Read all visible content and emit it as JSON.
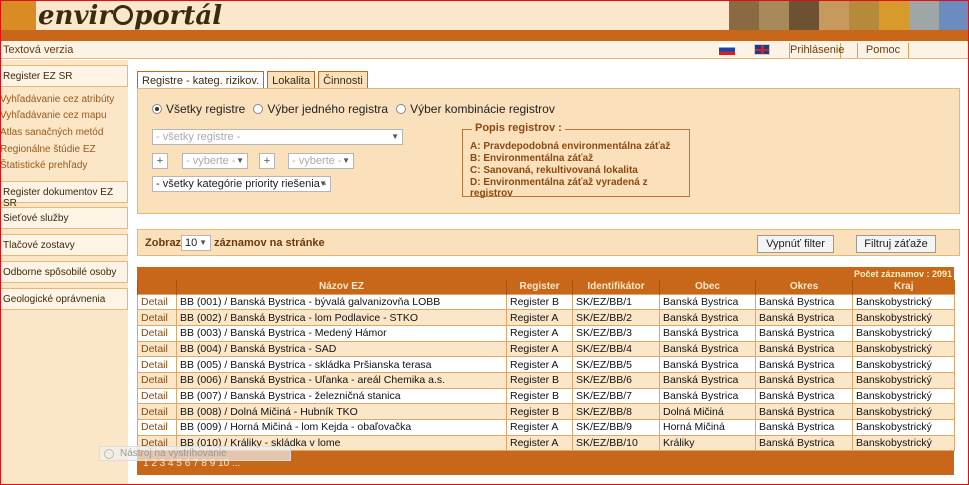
{
  "header": {
    "logo_prefix": "envir",
    "logo_suffix": "portál"
  },
  "subbar": {
    "text_version": "Textová verzia",
    "login": "Prihlásenie",
    "help": "Pomoc"
  },
  "sidebar": {
    "register_ez": "Register EZ SR",
    "links": [
      "Vyhľadávanie cez atribúty",
      "Vyhľadávanie cez mapu",
      "Atlas sanačných metód",
      "Regionálne štúdie EZ",
      "Štatistické prehľady"
    ],
    "sections": [
      "Register dokumentov EZ SR",
      "Sieťové služby",
      "Tlačové zostavy",
      "Odborne spôsobilé osoby",
      "Geologické oprávnenia"
    ]
  },
  "tabs": [
    "Registre - kateg. rizikov.",
    "Lokalita",
    "Činnosti"
  ],
  "filters": {
    "radio_all": "Všetky registre",
    "radio_one": "Výber jedného registra",
    "radio_combo": "Výber kombinácie registrov",
    "select_registers": "- všetky registre -",
    "select_pick": "- vyberte -",
    "plus": "+",
    "select_priority": "- všetky kategórie priority riešenia -",
    "legend_title": "Popis registrov :",
    "legend_items": [
      "A: Pravdepodobná environmentálna záťaž",
      "B: Environmentálna záťaž",
      "C: Sanovaná, rekultivovaná lokalita",
      "D: Environmentálna záťaž vyradená z registrov"
    ]
  },
  "controls": {
    "show": "Zobraziť",
    "per_page": "10",
    "per_page_suffix": "záznamov na stránke",
    "reset_filter": "Vypnúť filter",
    "filter": "Filtruj záťaže"
  },
  "table": {
    "count_label": "Počet záznamov : 2091",
    "headers": [
      "",
      "Názov EZ",
      "Register",
      "Identifikátor",
      "Obec",
      "Okres",
      "Kraj"
    ],
    "rows": [
      [
        "Detail",
        "BB (001) / Banská Bystrica - bývalá galvanizovňa LOBB",
        "Register B",
        "SK/EZ/BB/1",
        "Banská Bystrica",
        "Banská Bystrica",
        "Banskobystrický"
      ],
      [
        "Detail",
        "BB (002) / Banská Bystrica - lom Podlavice - STKO",
        "Register A",
        "SK/EZ/BB/2",
        "Banská Bystrica",
        "Banská Bystrica",
        "Banskobystrický"
      ],
      [
        "Detail",
        "BB (003) / Banská Bystrica - Medený Hámor",
        "Register A",
        "SK/EZ/BB/3",
        "Banská Bystrica",
        "Banská Bystrica",
        "Banskobystrický"
      ],
      [
        "Detail",
        "BB (004) / Banská Bystrica - SAD",
        "Register A",
        "SK/EZ/BB/4",
        "Banská Bystrica",
        "Banská Bystrica",
        "Banskobystrický"
      ],
      [
        "Detail",
        "BB (005) / Banská Bystrica - skládka Pršianska terasa",
        "Register A",
        "SK/EZ/BB/5",
        "Banská Bystrica",
        "Banská Bystrica",
        "Banskobystrický"
      ],
      [
        "Detail",
        "BB (006) / Banská Bystrica - Uľanka - areál Chemika a.s.",
        "Register B",
        "SK/EZ/BB/6",
        "Banská Bystrica",
        "Banská Bystrica",
        "Banskobystrický"
      ],
      [
        "Detail",
        "BB (007) / Banská Bystrica - železničná stanica",
        "Register B",
        "SK/EZ/BB/7",
        "Banská Bystrica",
        "Banská Bystrica",
        "Banskobystrický"
      ],
      [
        "Detail",
        "BB (008) / Dolná Mičiná - Hubník TKO",
        "Register B",
        "SK/EZ/BB/8",
        "Dolná Mičiná",
        "Banská Bystrica",
        "Banskobystrický"
      ],
      [
        "Detail",
        "BB (009) / Horná Mičiná - lom Kejda - obaľovačka",
        "Register A",
        "SK/EZ/BB/9",
        "Horná Mičiná",
        "Banská Bystrica",
        "Banskobystrický"
      ],
      [
        "Detail",
        "BB (010) / Králiky - skládka v lome",
        "Register A",
        "SK/EZ/BB/10",
        "Králiky",
        "Banská Bystrica",
        "Banskobystrický"
      ]
    ],
    "pager": "1 2 3 4 5 6 7 8 9 10 ..."
  },
  "tooltip": "Nástroj na vystrihovanie"
}
